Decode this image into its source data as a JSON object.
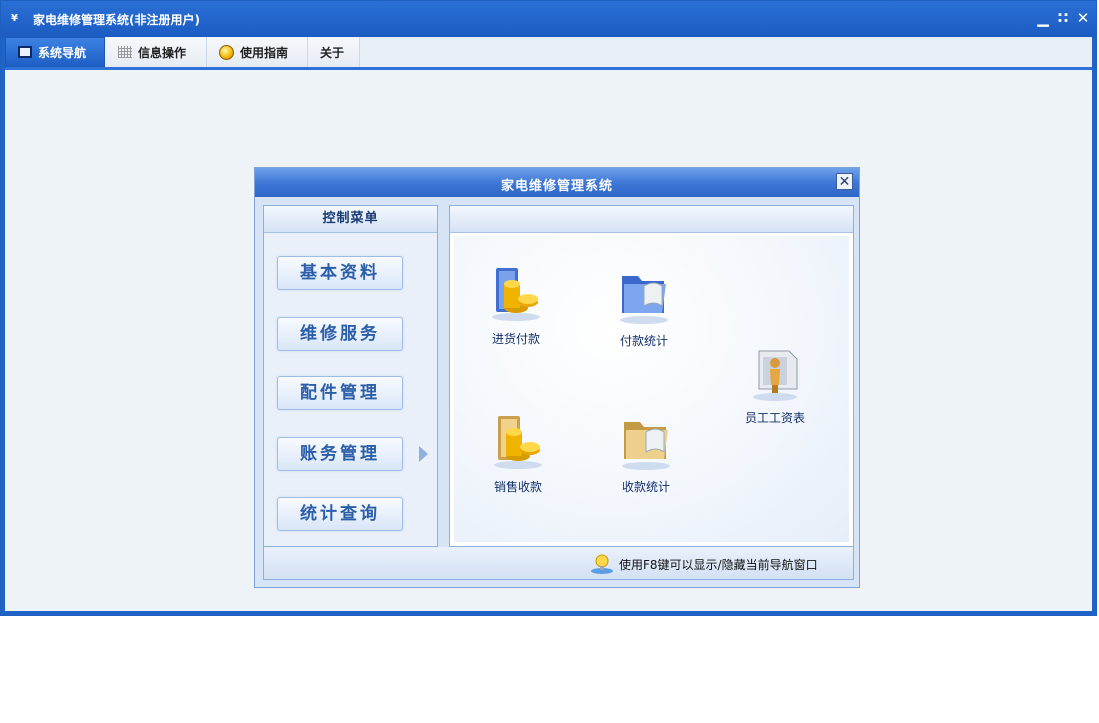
{
  "window": {
    "title": "家电维修管理系统(非注册用户)",
    "logo_text": "¥",
    "controls": {
      "minimize": "▁",
      "restore": "∷",
      "close": "✕"
    }
  },
  "menubar": {
    "tabs": [
      {
        "label": "系统导航",
        "icon": "monitor-icon",
        "active": true
      },
      {
        "label": "信息操作",
        "icon": "grid-icon",
        "active": false
      },
      {
        "label": "使用指南",
        "icon": "help-icon",
        "active": false
      },
      {
        "label": "关于",
        "icon": "",
        "active": false
      }
    ]
  },
  "dialog": {
    "title": "家电维修管理系统",
    "close_glyph": "✕",
    "left_panel": {
      "header": "控制菜单",
      "items": [
        "基本资料",
        "维修服务",
        "配件管理",
        "账务管理",
        "统计查询"
      ],
      "selected": "账务管理"
    },
    "functions": [
      {
        "label": "进货付款",
        "icon": "purchase-payment-icon"
      },
      {
        "label": "付款统计",
        "icon": "payment-stats-icon"
      },
      {
        "label": "员工工资表",
        "icon": "employee-salary-icon"
      },
      {
        "label": "销售收款",
        "icon": "sales-receipt-icon"
      },
      {
        "label": "收款统计",
        "icon": "receipt-stats-icon"
      }
    ],
    "status_tip": "使用F8键可以显示/隐藏当前导航窗口"
  },
  "colors": {
    "titlebar": "#1f63c8",
    "accent": "#2f72d9",
    "workspace": "#eef3f8",
    "menu_text": "#2b5ea8"
  }
}
